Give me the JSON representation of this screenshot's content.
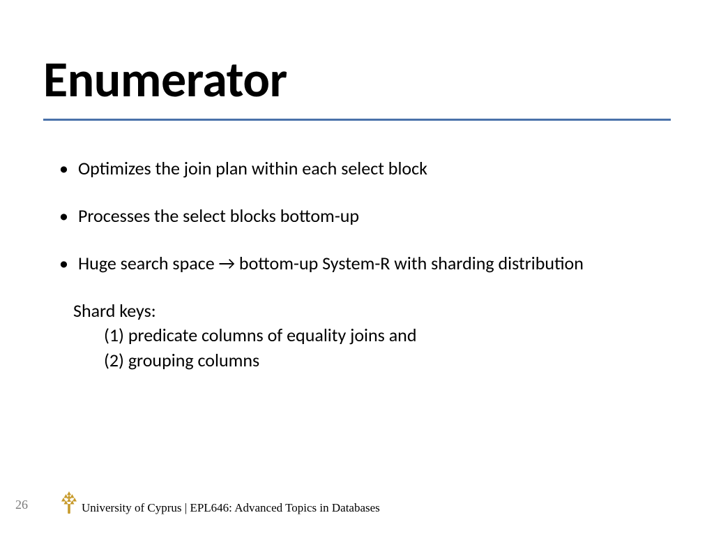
{
  "title": "Enumerator",
  "bullets": [
    "Optimizes the join plan within each select block",
    "Processes the select blocks bottom-up",
    "Huge search space → bottom-up System-R with sharding distribution"
  ],
  "sub": {
    "header": "Shard keys:",
    "line1": "(1) predicate columns of equality joins and",
    "line2": "(2) grouping columns"
  },
  "footer": {
    "page": "26",
    "text": "University of Cyprus | EPL646: Advanced Topics in Databases"
  }
}
